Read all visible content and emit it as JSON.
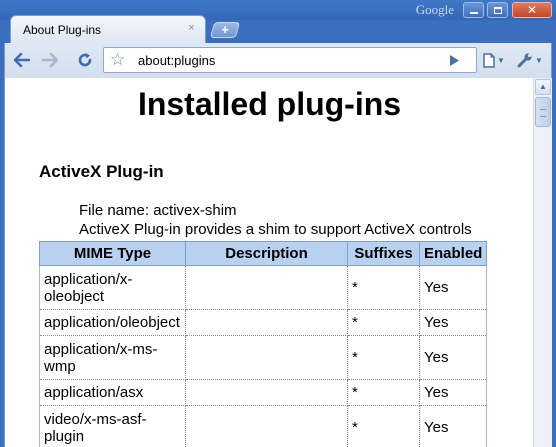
{
  "window": {
    "brand": "Google",
    "tab_title": "About Plug-ins",
    "tab_close": "×",
    "new_tab": "+"
  },
  "toolbar": {
    "url": "about:plugins"
  },
  "page": {
    "title": "Installed plug-ins",
    "plugin": {
      "name": "ActiveX Plug-in",
      "file_name": "File name: activex-shim",
      "description": "ActiveX Plug-in provides a shim to support ActiveX controls"
    },
    "table": {
      "headers": [
        "MIME Type",
        "Description",
        "Suffixes",
        "Enabled"
      ],
      "rows": [
        {
          "mime": "application/x-oleobject",
          "description": "",
          "suffixes": "*",
          "enabled": "Yes"
        },
        {
          "mime": "application/oleobject",
          "description": "",
          "suffixes": "*",
          "enabled": "Yes"
        },
        {
          "mime": "application/x-ms-wmp",
          "description": "",
          "suffixes": "*",
          "enabled": "Yes"
        },
        {
          "mime": "application/asx",
          "description": "",
          "suffixes": "*",
          "enabled": "Yes"
        },
        {
          "mime": "video/x-ms-asf-plugin",
          "description": "",
          "suffixes": "*",
          "enabled": "Yes"
        }
      ]
    }
  },
  "colors": {
    "frame": "#3a6fbf",
    "table_header": "#b9d1f0"
  }
}
